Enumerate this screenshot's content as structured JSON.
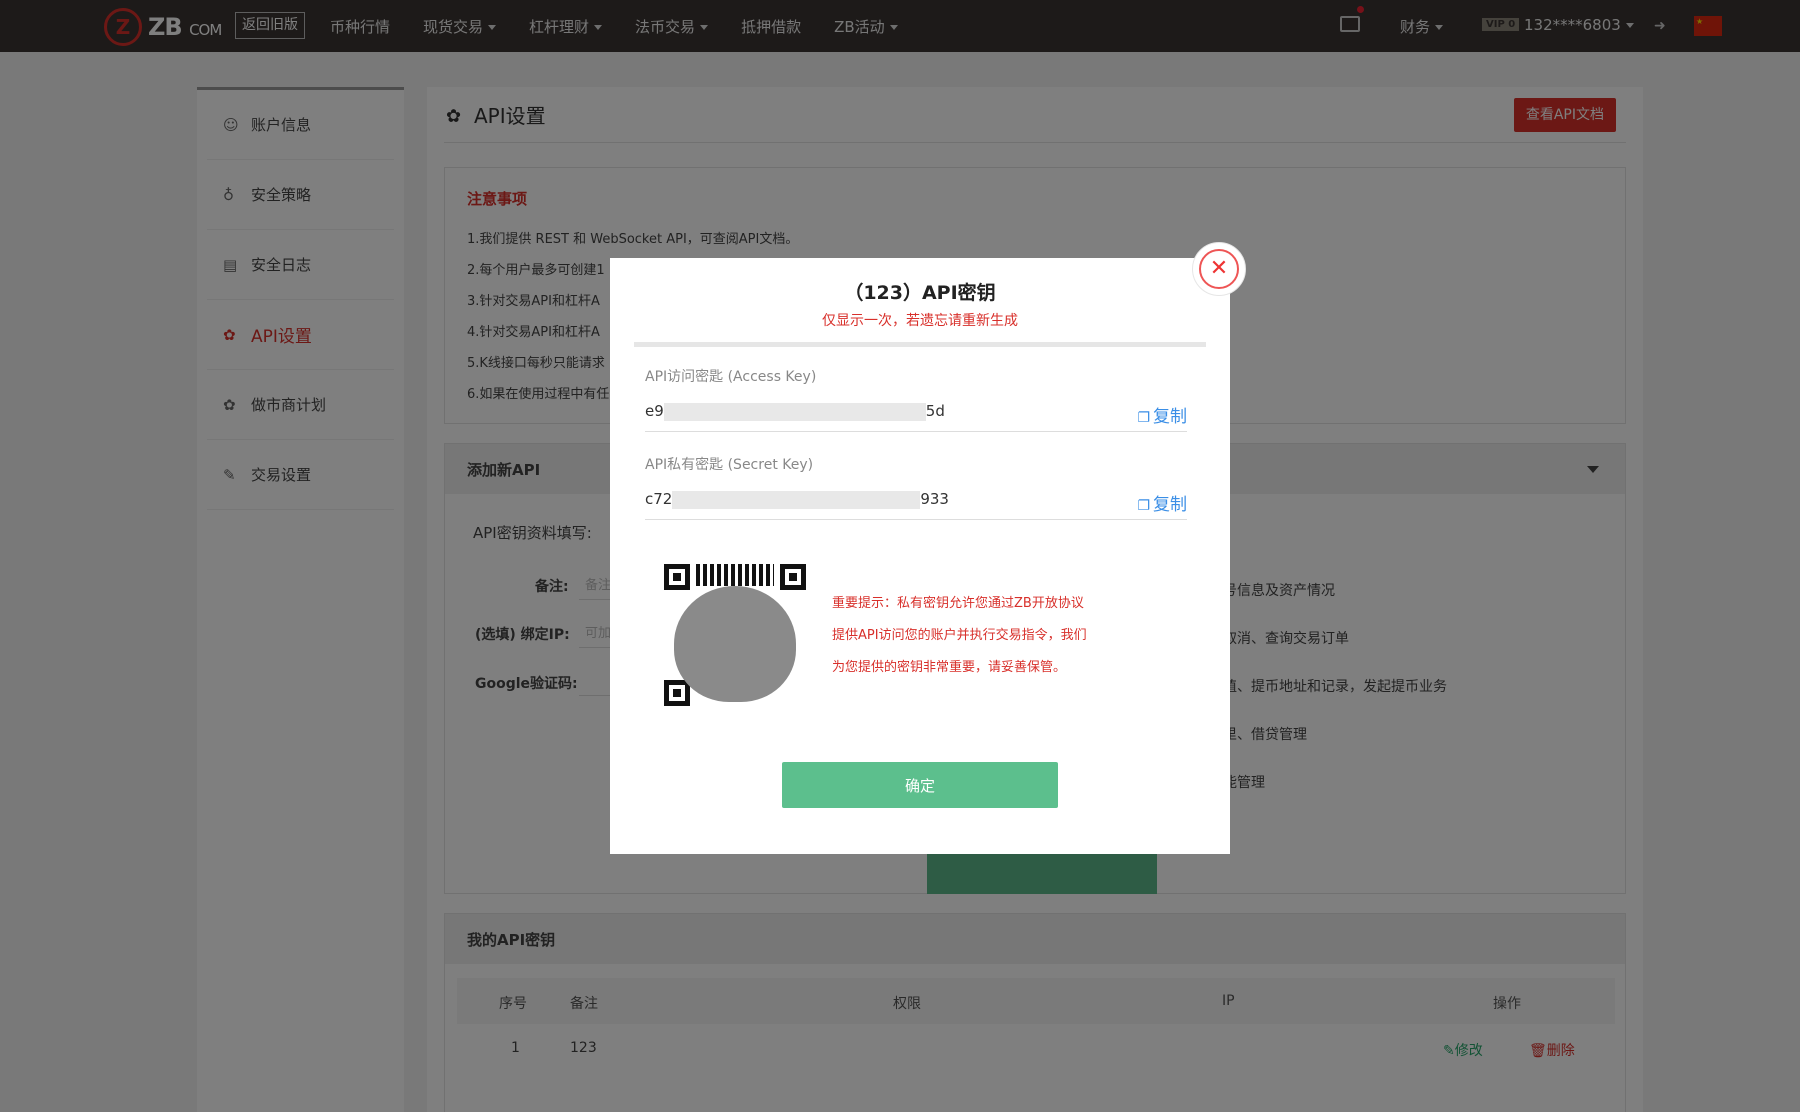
{
  "topbar": {
    "brand_mark": "Z",
    "brand_name": "ZB",
    "brand_suffix": "COM",
    "old_version": "返回旧版",
    "nav": [
      "币种行情",
      "现货交易",
      "杠杆理财",
      "法币交易",
      "抵押借款",
      "ZB活动"
    ],
    "finance": "财务",
    "vip": "VIP 0",
    "user": "132****6803",
    "flag_star": "★"
  },
  "sidebar": {
    "items": [
      {
        "label": "账户信息",
        "icon": "user-icon"
      },
      {
        "label": "安全策略",
        "icon": "bulb-icon"
      },
      {
        "label": "安全日志",
        "icon": "doc-icon"
      },
      {
        "label": "API设置",
        "icon": "api-icon"
      },
      {
        "label": "做市商计划",
        "icon": "api-icon"
      },
      {
        "label": "交易设置",
        "icon": "wrench-icon"
      }
    ]
  },
  "main": {
    "title": "API设置",
    "doc_button": "查看API文档",
    "notice": {
      "title": "注意事项",
      "lines": [
        "1.我们提供 REST 和 WebSocket API，可查阅API文档。",
        "2.每个用户最多可创建1",
        "3.针对交易API和杠杆A",
        "4.针对交易API和杠杆A",
        "5.K线接口每秒只能请求",
        "6.如果在使用过程中有任"
      ]
    },
    "add": {
      "header": "添加新API",
      "fill_label": "API密钥资料填写:",
      "remark_label": "备注:",
      "remark_placeholder": "备注",
      "ip_label": "(选填) 绑定IP:",
      "ip_placeholder": "可加",
      "google_label": "Google验证码:",
      "perms": [
        "号信息及资产情况",
        "取消、查询交易订单",
        "值、提币地址和记录，发起提币业务",
        "里、借贷管理",
        "能管理"
      ]
    },
    "keys": {
      "header": "我的API密钥",
      "columns": [
        "序号",
        "备注",
        "权限",
        "IP",
        "操作"
      ],
      "row": {
        "no": "1",
        "remark": "123",
        "edit": "修改",
        "delete": "删除"
      }
    }
  },
  "modal": {
    "title": "（123）API密钥",
    "subtitle": "仅显示一次，若遗忘请重新生成",
    "access_label": "API访问密匙 (Access Key)",
    "access_prefix": "e9",
    "access_suffix": "5d",
    "secret_label": "API私有密匙 (Secret Key)",
    "secret_prefix": "c72",
    "secret_suffix": "933",
    "copy": "复制",
    "tip_lines": [
      "重要提示：私有密钥允许您通过ZB开放协议",
      "提供API访问您的账户并执行交易指令，我们",
      "为您提供的密钥非常重要，请妥善保管。"
    ],
    "confirm": "确定"
  }
}
